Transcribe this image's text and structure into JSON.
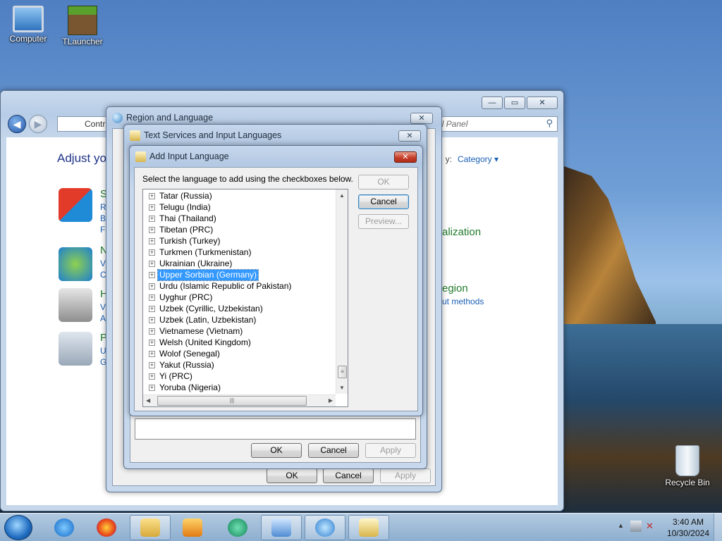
{
  "desktop": {
    "icons": [
      {
        "label": "Computer"
      },
      {
        "label": "TLauncher"
      },
      {
        "label": "Recycle Bin"
      }
    ]
  },
  "control_panel": {
    "address_text": "Contr",
    "search_placeholder": "ol Panel",
    "heading": "Adjust you",
    "view_by_label": "y:",
    "view_by_value": "Category ▾",
    "left_categories": [
      {
        "title": "S",
        "sub1": "Re",
        "sub2": "Ba",
        "sub3": "Fi"
      },
      {
        "title": "N",
        "sub1": "Vi",
        "sub2": "C"
      },
      {
        "title": "H",
        "sub1": "Vi",
        "sub2": "A"
      },
      {
        "title": "P",
        "sub1": "U",
        "sub2": "G"
      }
    ],
    "right_heading_1": "alization",
    "right_heading_2": "egion",
    "right_link_2": "ut methods"
  },
  "region_dialog": {
    "title": "Region and Language",
    "ok": "OK",
    "cancel": "Cancel",
    "apply": "Apply"
  },
  "text_services_dialog": {
    "title": "Text Services and Input Languages",
    "ok": "OK",
    "cancel": "Cancel",
    "apply": "Apply"
  },
  "add_input_dialog": {
    "title": "Add Input Language",
    "instruction": "Select the language to add using the checkboxes below.",
    "ok": "OK",
    "cancel": "Cancel",
    "preview": "Preview...",
    "selected_index": 7,
    "languages": [
      "Tatar (Russia)",
      "Telugu (India)",
      "Thai (Thailand)",
      "Tibetan (PRC)",
      "Turkish (Turkey)",
      "Turkmen (Turkmenistan)",
      "Ukrainian (Ukraine)",
      "Upper Sorbian (Germany)",
      "Urdu (Islamic Republic of Pakistan)",
      "Uyghur (PRC)",
      "Uzbek (Cyrillic, Uzbekistan)",
      "Uzbek (Latin, Uzbekistan)",
      "Vietnamese (Vietnam)",
      "Welsh (United Kingdom)",
      "Wolof (Senegal)",
      "Yakut (Russia)",
      "Yi (PRC)",
      "Yoruba (Nigeria)"
    ]
  },
  "taskbar": {
    "time": "3:40 AM",
    "date": "10/30/2024",
    "items": [
      "start-orb",
      "internet-explorer",
      "firefox",
      "file-explorer",
      "media-player",
      "app-green",
      "control-panel",
      "region-globe",
      "keyboard-settings"
    ]
  }
}
